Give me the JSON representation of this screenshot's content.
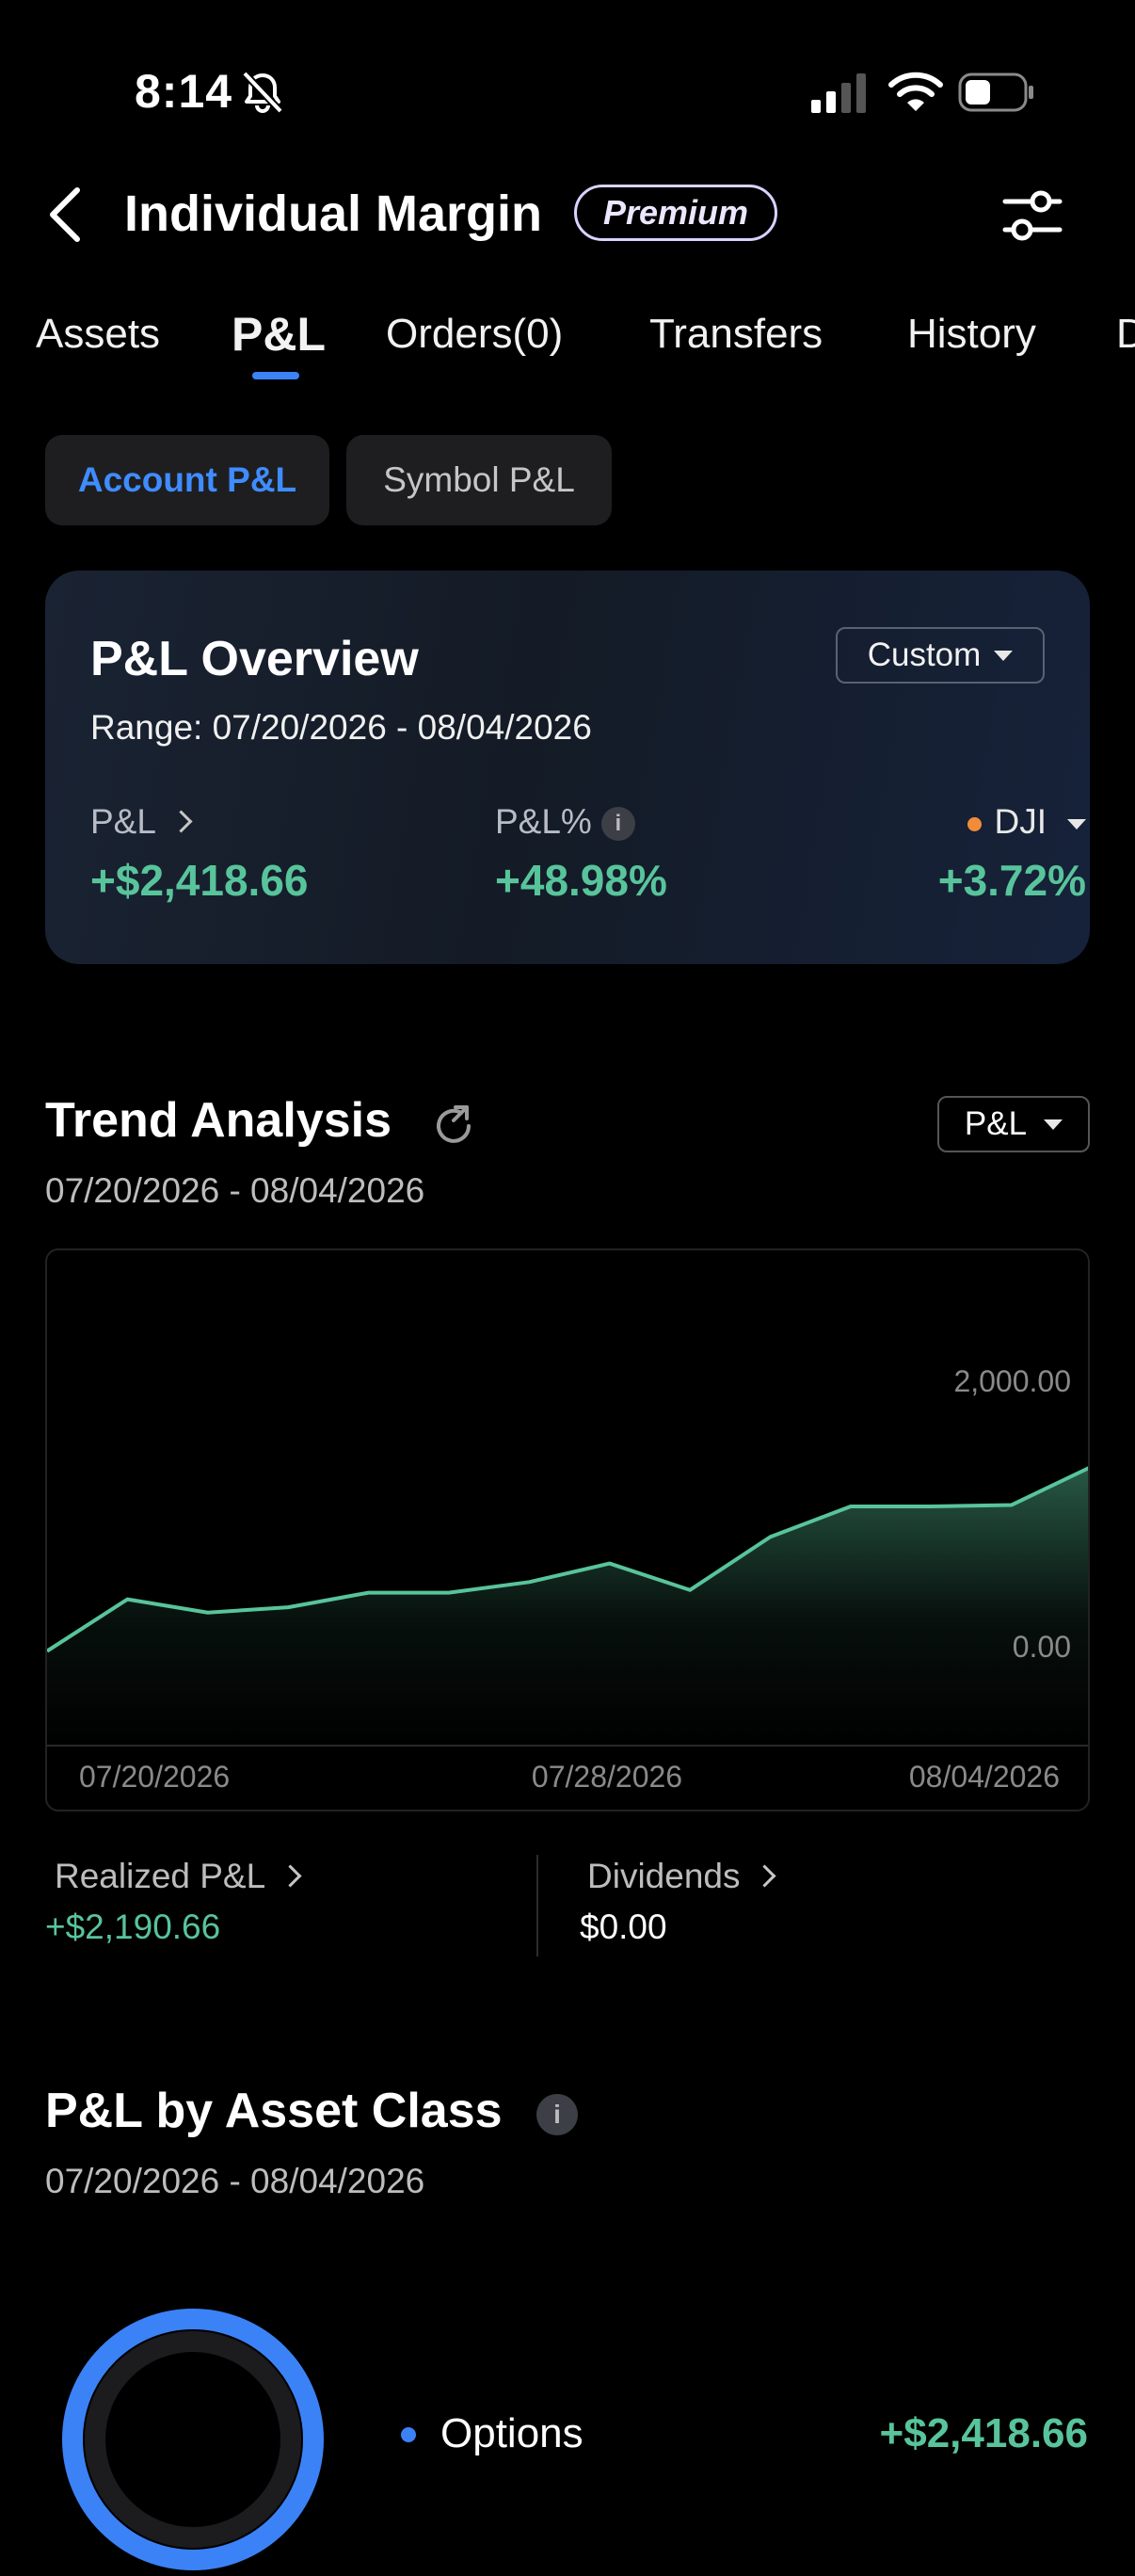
{
  "status": {
    "time": "8:14"
  },
  "header": {
    "title": "Individual Margin",
    "badge": "Premium"
  },
  "tabs": [
    "Assets",
    "P&L",
    "Orders(0)",
    "Transfers",
    "History",
    "D"
  ],
  "active_tab": "P&L",
  "subtoggle": {
    "account": "Account P&L",
    "symbol": "Symbol P&L",
    "active": "Account P&L"
  },
  "overview": {
    "title": "P&L Overview",
    "period_selector": "Custom",
    "range": "Range: 07/20/2026 - 08/04/2026",
    "pl_label": "P&L",
    "pl_value": "+$2,418.66",
    "plpct_label": "P&L%",
    "plpct_value": "+48.98%",
    "index_label": "DJI",
    "index_value": "+3.72%"
  },
  "trend": {
    "title": "Trend Analysis",
    "metric_selector": "P&L",
    "range": "07/20/2026 - 08/04/2026"
  },
  "chart_data": {
    "type": "area",
    "x": [
      "07/20/2026",
      "07/21/2026",
      "07/22/2026",
      "07/23/2026",
      "07/24/2026",
      "07/27/2026",
      "07/28/2026",
      "07/29/2026",
      "07/30/2026",
      "07/31/2026",
      "08/01/2026",
      "08/02/2026",
      "08/03/2026",
      "08/04/2026"
    ],
    "values": [
      -40,
      350,
      250,
      290,
      400,
      400,
      480,
      620,
      420,
      820,
      1050,
      1050,
      1060,
      1350
    ],
    "y_tick_values": [
      0,
      2000
    ],
    "y_tick_labels": [
      "0.00",
      "2,000.00"
    ],
    "x_tick_labels": [
      "07/20/2026",
      "07/28/2026",
      "08/04/2026"
    ],
    "line_color": "#58c49b"
  },
  "summary": {
    "realized_label": "Realized P&L",
    "realized_value": "+$2,190.66",
    "dividends_label": "Dividends",
    "dividends_value": "$0.00"
  },
  "asset_class": {
    "title": "P&L by Asset Class",
    "range": "07/20/2026 - 08/04/2026",
    "items": [
      {
        "label": "Options",
        "value": "+$2,418.66",
        "color": "#3b82f6"
      }
    ]
  }
}
